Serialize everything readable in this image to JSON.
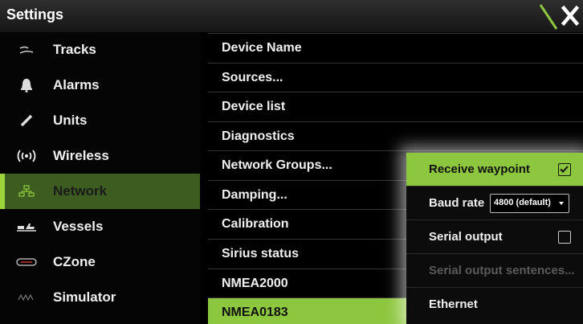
{
  "window": {
    "title": "Settings"
  },
  "colors": {
    "accent": "#8dc63f",
    "active_sidebar_bg": "#3c5c20",
    "background": "#000000"
  },
  "sidebar": {
    "items": [
      {
        "label": "Tracks",
        "icon": "tracks-icon",
        "active": false
      },
      {
        "label": "Alarms",
        "icon": "bell-icon",
        "active": false
      },
      {
        "label": "Units",
        "icon": "ruler-icon",
        "active": false
      },
      {
        "label": "Wireless",
        "icon": "wireless-icon",
        "active": false
      },
      {
        "label": "Network",
        "icon": "network-icon",
        "active": true
      },
      {
        "label": "Vessels",
        "icon": "vessels-icon",
        "active": false
      },
      {
        "label": "CZone",
        "icon": "czone-icon",
        "active": false
      },
      {
        "label": "Simulator",
        "icon": "simulator-icon",
        "active": false
      }
    ]
  },
  "menu": {
    "items": [
      {
        "label": "Device Name"
      },
      {
        "label": "Sources..."
      },
      {
        "label": "Device list"
      },
      {
        "label": "Diagnostics"
      },
      {
        "label": "Network Groups..."
      },
      {
        "label": "Damping..."
      },
      {
        "label": "Calibration"
      },
      {
        "label": "Sirius status"
      },
      {
        "label": "NMEA2000"
      },
      {
        "label": "NMEA0183",
        "active": true
      }
    ]
  },
  "popup": {
    "receive_waypoint": {
      "label": "Receive waypoint",
      "checked": true
    },
    "baud_rate": {
      "label": "Baud rate",
      "value": "4800 (default)"
    },
    "serial_output": {
      "label": "Serial output",
      "checked": false
    },
    "serial_output_sentences": {
      "label": "Serial output sentences...",
      "disabled": true
    },
    "ethernet": {
      "label": "Ethernet"
    }
  }
}
